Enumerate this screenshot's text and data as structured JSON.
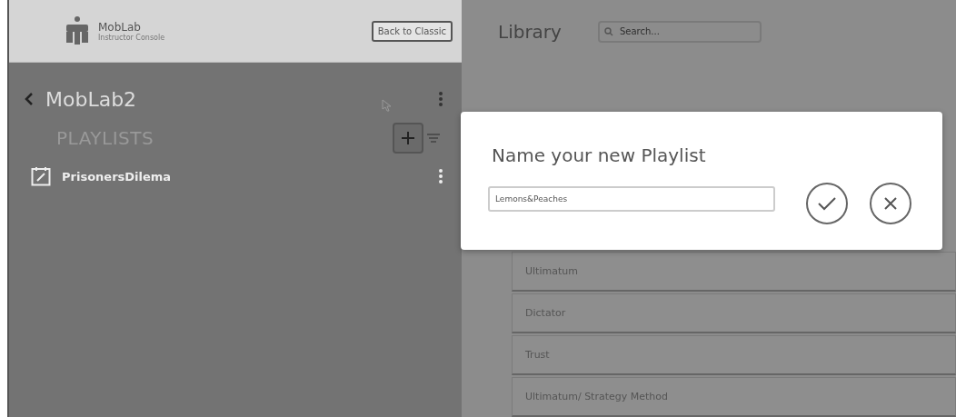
{
  "header": {
    "brand": "MobLab",
    "subtitle": "Instructor Console",
    "back_button": "Back to Classic"
  },
  "sidebar": {
    "title": "MobLab2",
    "section": "PLAYLISTS",
    "items": [
      {
        "label": "PrisonersDilema"
      }
    ]
  },
  "library": {
    "title": "Library",
    "search": {
      "placeholder": "Search..."
    },
    "items": [
      {
        "label": "Ultimatum"
      },
      {
        "label": "Dictator"
      },
      {
        "label": "Trust"
      },
      {
        "label": "Ultimatum/ Strategy Method"
      }
    ]
  },
  "dialog": {
    "title": "Name your new Playlist",
    "value": "Lemons&Peaches"
  }
}
